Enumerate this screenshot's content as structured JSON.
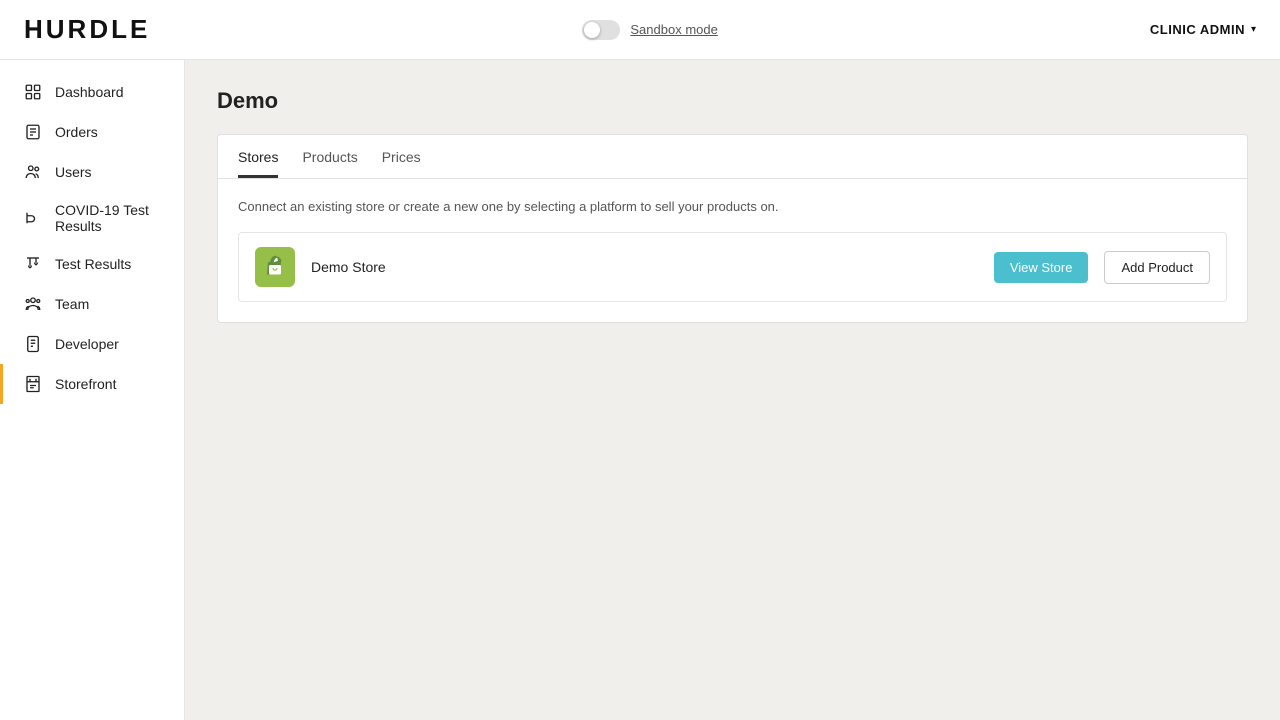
{
  "header": {
    "logo": "HURDLE",
    "sandbox_label": "Sandbox mode",
    "admin_label": "CLINIC ADMIN"
  },
  "sidebar": {
    "items": [
      {
        "id": "dashboard",
        "label": "Dashboard",
        "active": false
      },
      {
        "id": "orders",
        "label": "Orders",
        "active": false
      },
      {
        "id": "users",
        "label": "Users",
        "active": false
      },
      {
        "id": "covid19",
        "label": "COVID-19 Test Results",
        "active": false
      },
      {
        "id": "test-results",
        "label": "Test Results",
        "active": false
      },
      {
        "id": "team",
        "label": "Team",
        "active": false
      },
      {
        "id": "developer",
        "label": "Developer",
        "active": false
      },
      {
        "id": "storefront",
        "label": "Storefront",
        "active": true
      }
    ]
  },
  "main": {
    "page_title": "Demo",
    "tabs": [
      {
        "id": "stores",
        "label": "Stores",
        "active": true
      },
      {
        "id": "products",
        "label": "Products",
        "active": false
      },
      {
        "id": "prices",
        "label": "Prices",
        "active": false
      }
    ],
    "description": "Connect an existing store or create a new one by selecting a platform to sell your products on.",
    "store": {
      "name": "Demo Store",
      "view_label": "View Store",
      "add_label": "Add Product"
    }
  }
}
